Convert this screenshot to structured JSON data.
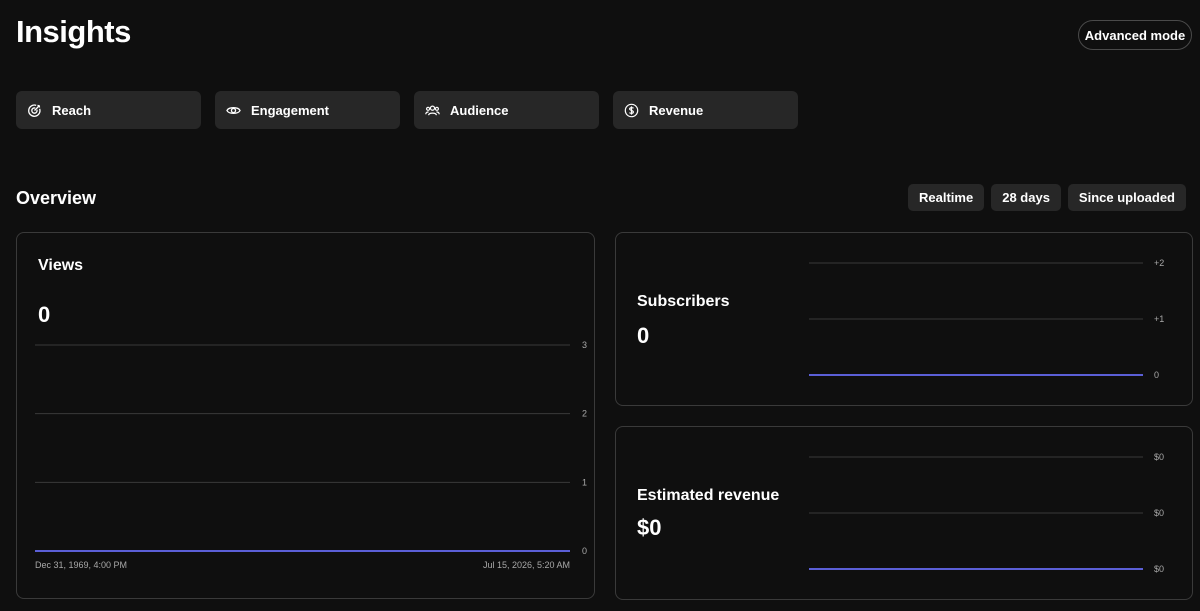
{
  "header": {
    "title": "Insights",
    "advanced_mode_label": "Advanced mode"
  },
  "tabs": [
    {
      "label": "Reach",
      "icon": "target-icon"
    },
    {
      "label": "Engagement",
      "icon": "eye-icon"
    },
    {
      "label": "Audience",
      "icon": "people-icon"
    },
    {
      "label": "Revenue",
      "icon": "dollar-circle-icon"
    }
  ],
  "overview": {
    "title": "Overview",
    "ranges": [
      "Realtime",
      "28 days",
      "Since uploaded"
    ]
  },
  "colors": {
    "background": "#0f0f0f",
    "tab_background": "#272727",
    "line": "#5b5fd6",
    "gridline": "#3a3a3a"
  },
  "cards": {
    "views": {
      "title": "Views",
      "value": "0"
    },
    "subscribers": {
      "title": "Subscribers",
      "value": "0"
    },
    "revenue": {
      "title": "Estimated revenue",
      "value": "$0"
    }
  },
  "chart_data": [
    {
      "type": "line",
      "title": "Views",
      "y_ticks": [
        "3",
        "2",
        "1",
        "0"
      ],
      "x_labels": [
        "Dec 31, 1969, 4:00 PM",
        "Jul 15, 2026, 5:20 AM"
      ],
      "ylim": [
        0,
        3
      ],
      "series": [
        {
          "values": [
            0,
            0
          ]
        }
      ]
    },
    {
      "type": "line",
      "title": "Subscribers",
      "y_ticks": [
        "+2",
        "+1",
        "0"
      ],
      "ylim": [
        0,
        2
      ],
      "series": [
        {
          "values": [
            0,
            0
          ]
        }
      ]
    },
    {
      "type": "line",
      "title": "Estimated revenue",
      "y_ticks": [
        "$0",
        "$0",
        "$0"
      ],
      "ylim": [
        0,
        2
      ],
      "series": [
        {
          "values": [
            0,
            0
          ]
        }
      ]
    }
  ]
}
